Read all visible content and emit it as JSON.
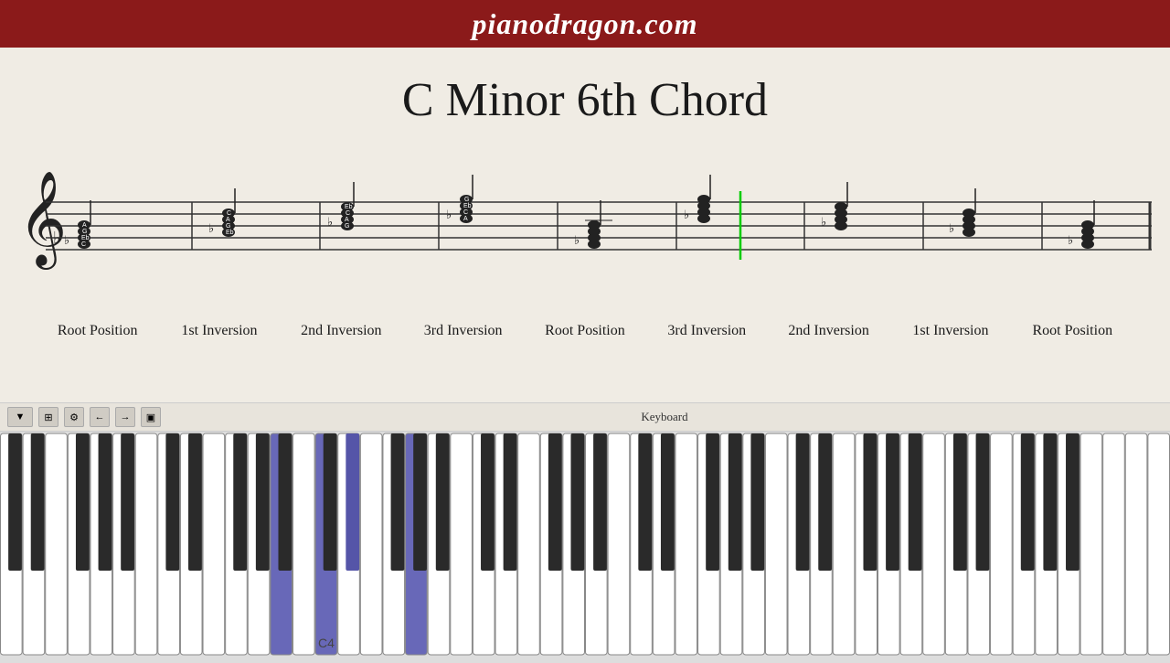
{
  "header": {
    "title": "pianodragon.com",
    "bg_color": "#8b1a1a"
  },
  "main": {
    "chord_title": "C Minor 6th Chord",
    "labels": [
      "Root Position",
      "1st Inversion",
      "2nd Inversion",
      "3rd Inversion",
      "Root Position",
      "3rd Inversion",
      "2nd Inversion",
      "1st Inversion",
      "Root Position"
    ]
  },
  "toolbar": {
    "label": "Keyboard"
  },
  "piano": {
    "c4_label": "C4"
  }
}
